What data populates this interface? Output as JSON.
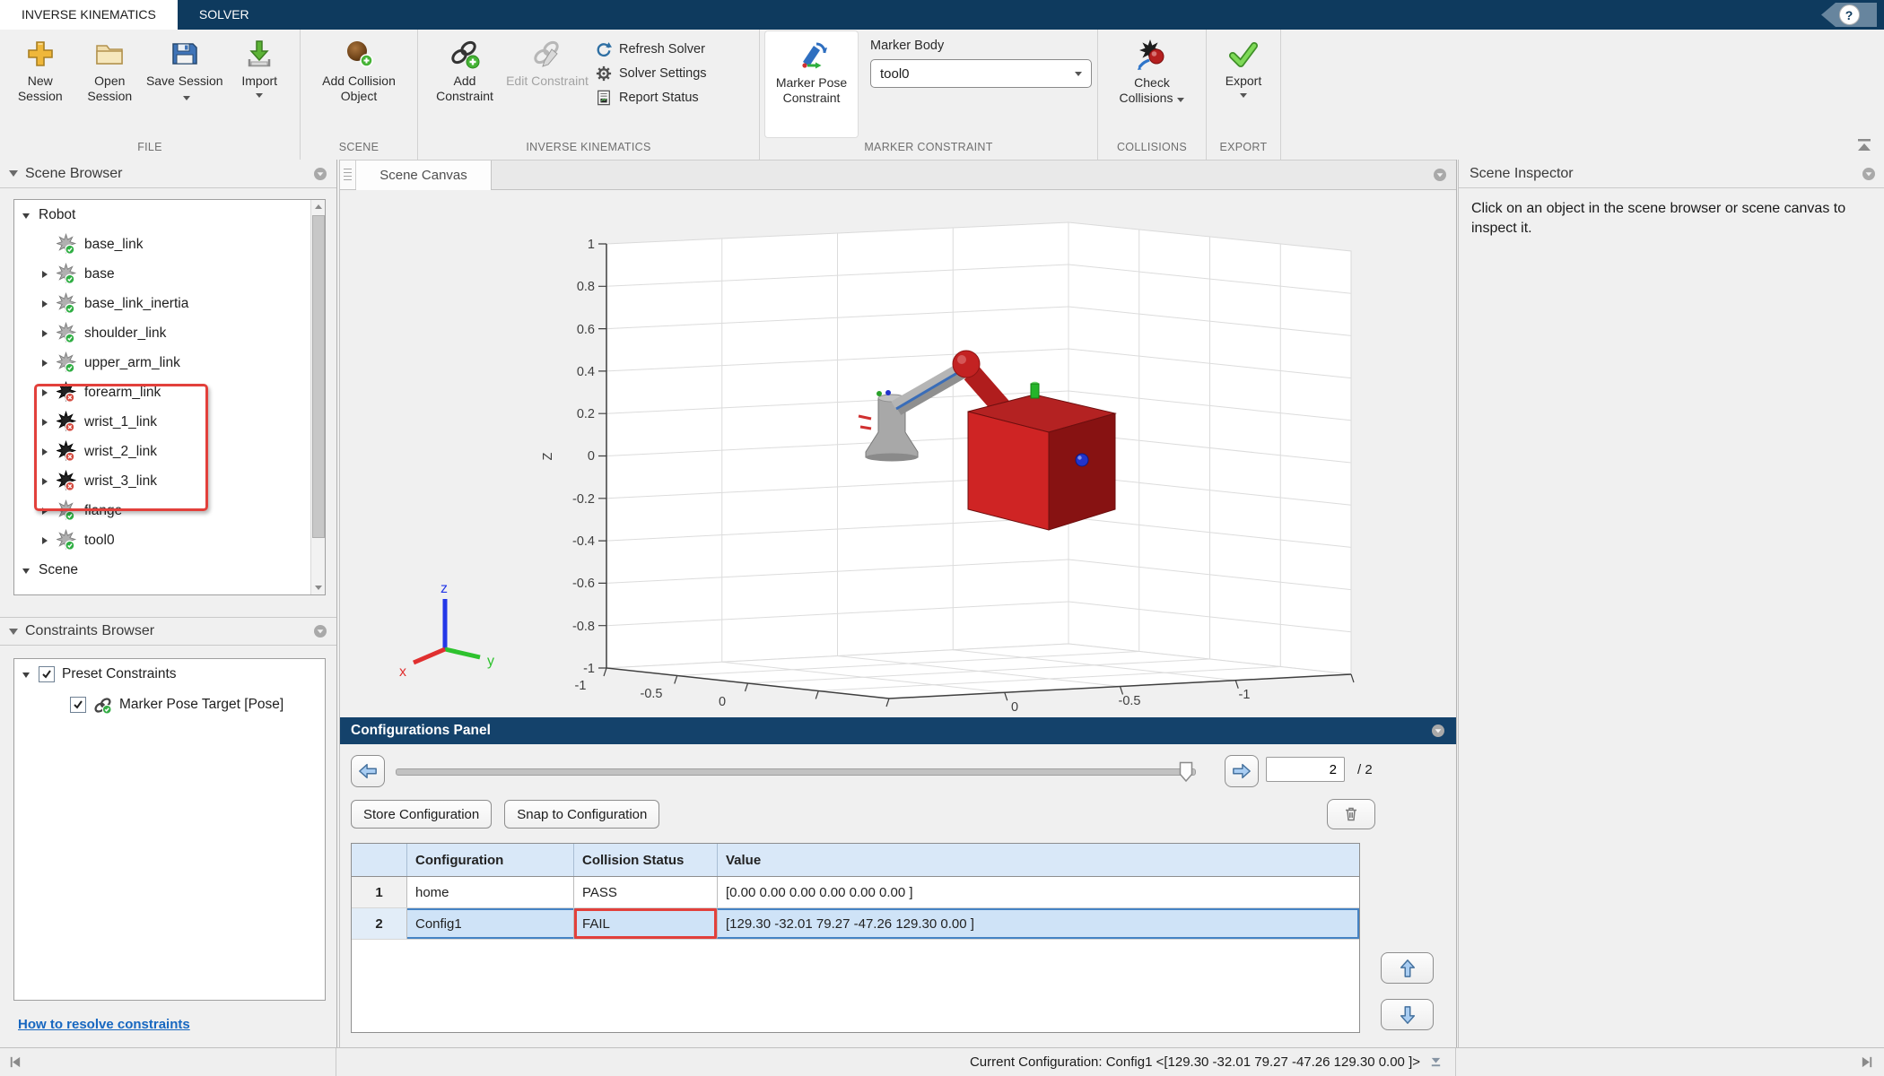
{
  "window": {
    "tabs": [
      {
        "label": "INVERSE KINEMATICS"
      },
      {
        "label": "SOLVER"
      }
    ],
    "help_label": "?"
  },
  "ribbon": {
    "file": {
      "section_label": "FILE",
      "new_session": "New Session",
      "open_session": "Open Session",
      "save_session": "Save Session",
      "import_label": "Import"
    },
    "scene": {
      "section_label": "SCENE",
      "add_collision_object": "Add Collision Object"
    },
    "inverse_kinematics": {
      "section_label": "INVERSE KINEMATICS",
      "add_constraint": "Add Constraint",
      "edit_constraint": "Edit Constraint",
      "refresh_solver": "Refresh Solver",
      "solver_settings": "Solver Settings",
      "report_status": "Report Status"
    },
    "marker_constraint": {
      "section_label": "MARKER CONSTRAINT",
      "marker_pose_constraint": "Marker Pose Constraint",
      "marker_body_label": "Marker Body",
      "marker_body_value": "tool0"
    },
    "collisions": {
      "section_label": "COLLISIONS",
      "check_collisions": "Check Collisions"
    },
    "export": {
      "section_label": "EXPORT",
      "export_label": "Export"
    }
  },
  "scene_browser": {
    "title": "Scene Browser",
    "items": [
      {
        "label": "Robot"
      },
      {
        "label": "base_link"
      },
      {
        "label": "base"
      },
      {
        "label": "base_link_inertia"
      },
      {
        "label": "shoulder_link"
      },
      {
        "label": "upper_arm_link"
      },
      {
        "label": "forearm_link"
      },
      {
        "label": "wrist_1_link"
      },
      {
        "label": "wrist_2_link"
      },
      {
        "label": "wrist_3_link"
      },
      {
        "label": "flange"
      },
      {
        "label": "tool0"
      },
      {
        "label": "Scene"
      }
    ]
  },
  "constraints_browser": {
    "title": "Constraints Browser",
    "preset_constraints": "Preset Constraints",
    "marker_pose_target": "Marker Pose Target [Pose]",
    "help_link": "How to resolve constraints"
  },
  "scene_canvas": {
    "tab_label": "Scene Canvas",
    "z_axis_label": "Z",
    "z_ticks": [
      "1",
      "0.8",
      "0.6",
      "0.4",
      "0.2",
      "0",
      "-0.2",
      "-0.4",
      "-0.6",
      "-0.8",
      "-1"
    ],
    "x_ticks": [
      "-1",
      "-0.5",
      "0"
    ],
    "y_ticks": [
      "0",
      "-0.5",
      "-1"
    ],
    "triad": {
      "x": "x",
      "y": "y",
      "z": "z"
    }
  },
  "scene_inspector": {
    "title": "Scene Inspector",
    "placeholder_message": "Click on an object in the scene browser or scene canvas to inspect it."
  },
  "configurations_panel": {
    "title": "Configurations Panel",
    "index_value": "2",
    "index_total": "/ 2",
    "store_configuration": "Store Configuration",
    "snap_to_configuration": "Snap to Configuration",
    "table": {
      "headers": [
        "",
        "Configuration",
        "Collision Status",
        "Value"
      ],
      "rows": [
        {
          "num": "1",
          "configuration": "home",
          "collision_status": "PASS",
          "value": "[0.00 0.00 0.00 0.00 0.00 0.00 ]"
        },
        {
          "num": "2",
          "configuration": "Config1",
          "collision_status": "FAIL",
          "value": "[129.30 -32.01 79.27 -47.26 129.30 0.00 ]"
        }
      ]
    }
  },
  "status_bar": {
    "current_configuration": "Current Configuration: Config1 <[129.30 -32.01 79.27 -47.26 129.30 0.00 ]>"
  },
  "icons": {
    "new_session": "gold-plus",
    "open_session": "folder",
    "save_session": "floppy-disk",
    "import": "green-download-arrow",
    "add_collision_object": "sphere-plus",
    "add_constraint": "chain-plus",
    "edit_constraint": "chain-pencil",
    "refresh_solver": "circular-arrow",
    "solver_settings": "gear",
    "report_status": "report-document",
    "marker_pose_constraint": "pose-marker",
    "check_collisions": "collision-star",
    "export": "green-check",
    "help": "question-mark",
    "delete": "trash-can",
    "collision_ok": "star-green-check",
    "collision_fail": "star-red-cross"
  },
  "colors": {
    "navy": "#0e3a5e",
    "ribbon_bg": "#f0f0f0",
    "selection_blue": "#cfe3f7",
    "table_header_blue": "#d9e8f8",
    "highlight_red": "#e2403b",
    "link_blue": "#1767c0",
    "robot_collision_red": "#c42020",
    "robot_gray": "#9a9a9a"
  }
}
